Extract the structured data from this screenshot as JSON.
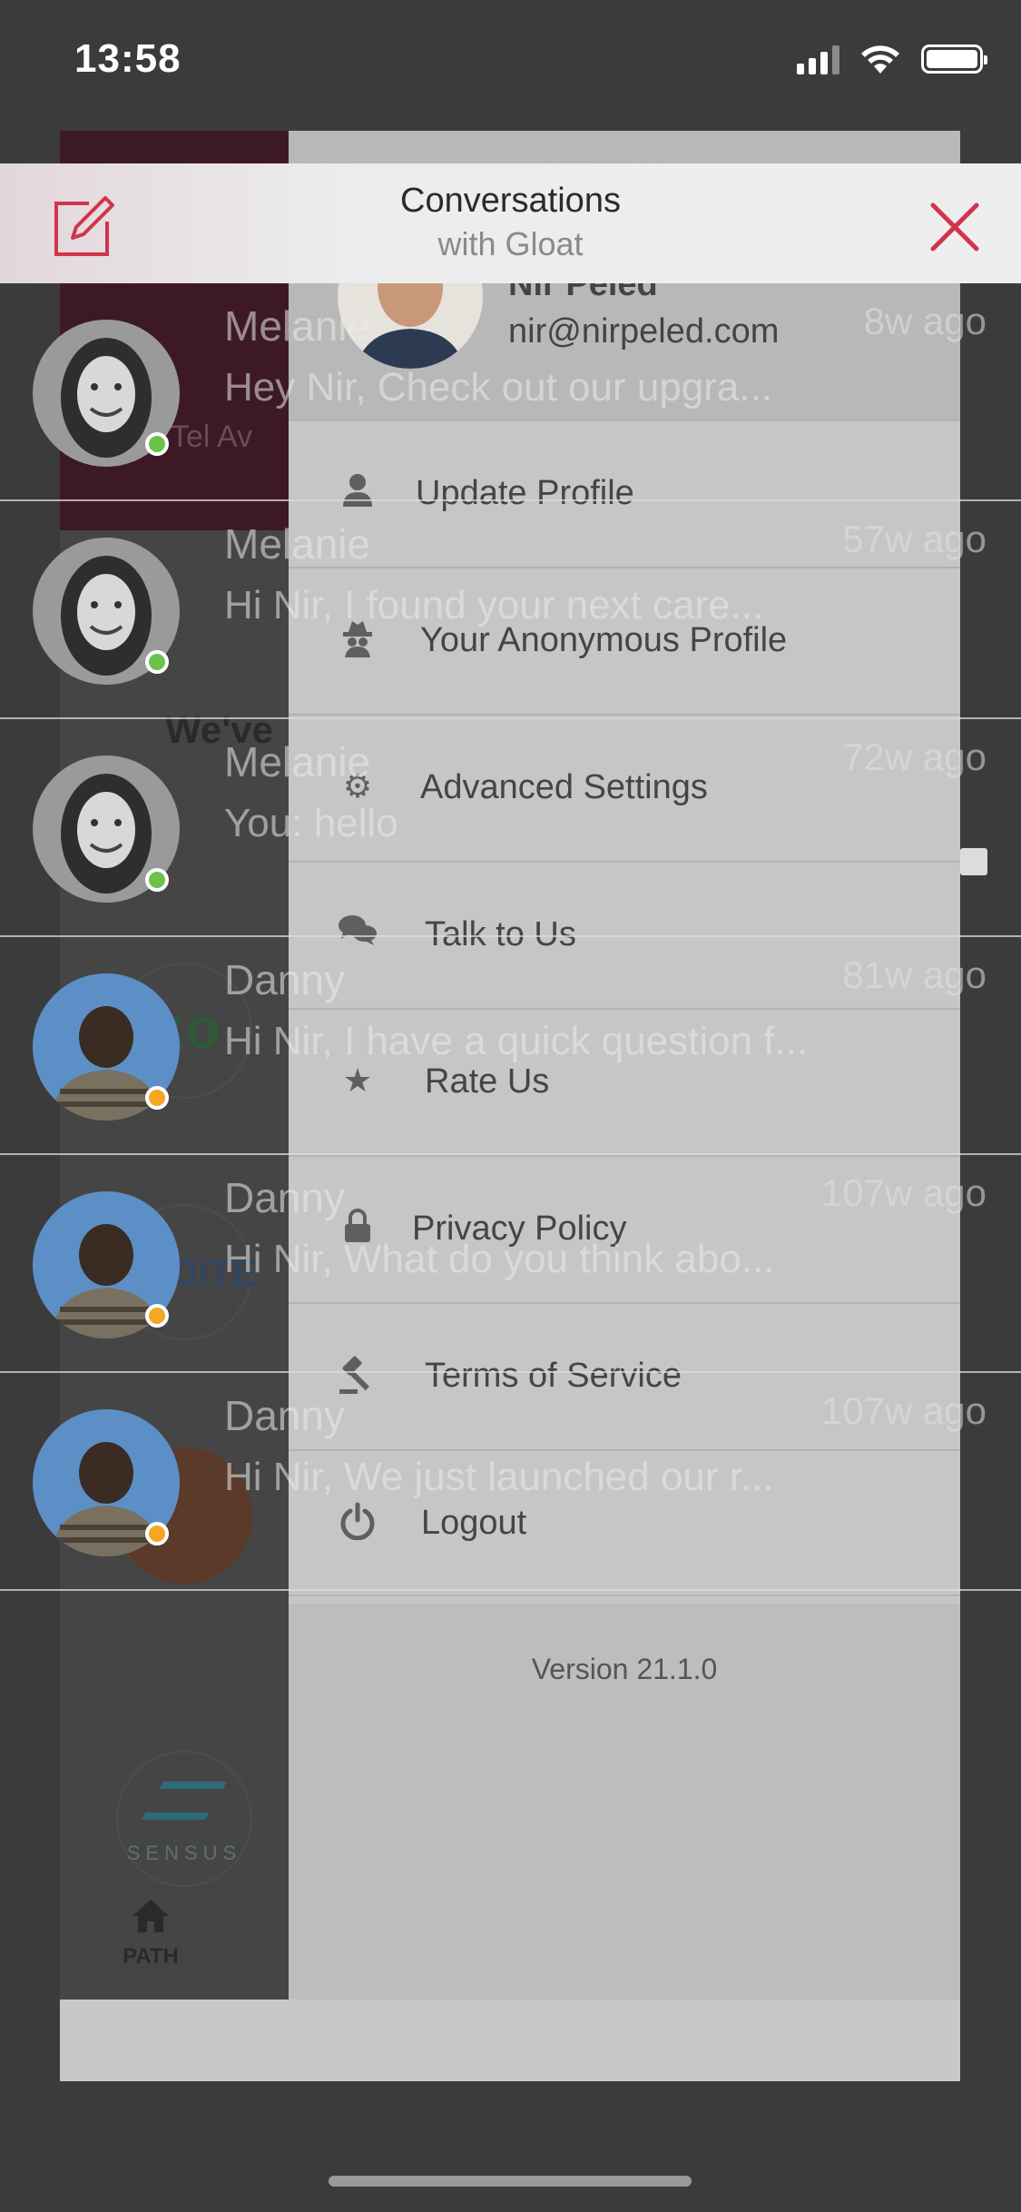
{
  "status_bar": {
    "time": "13:58"
  },
  "header": {
    "title": "Conversations",
    "subtitle": "with Gloat",
    "accent_color": "#d0354c"
  },
  "menu": {
    "user_name": "Nir Peled",
    "user_email": "nir@nirpeled.com",
    "items": [
      {
        "label": "Update Profile",
        "icon": "user-icon"
      },
      {
        "label": "Your Anonymous Profile",
        "icon": "incognito-icon"
      },
      {
        "label": "Advanced Settings",
        "icon": "gear-icon"
      },
      {
        "label": "Talk to Us",
        "icon": "chat-bubbles-icon"
      },
      {
        "label": "Rate Us",
        "icon": "star-icon"
      },
      {
        "label": "Privacy Policy",
        "icon": "lock-icon"
      },
      {
        "label": "Terms of Service",
        "icon": "gavel-icon"
      },
      {
        "label": "Logout",
        "icon": "power-icon"
      }
    ],
    "version": "Version 21.1.0"
  },
  "background": {
    "tel_text": "Tel Av",
    "we_text": "We've",
    "ko_text": "ko",
    "dite_text": "DITE",
    "sensus_text": "SENSUS",
    "path_label": "PATH"
  },
  "conversations": [
    {
      "name": "Melanie",
      "preview": "Hey Nir, Check out our upgra...",
      "time": "8w ago",
      "status_color": "#6cc24a"
    },
    {
      "name": "Melanie",
      "preview": "Hi Nir, I found your next care...",
      "time": "57w ago",
      "status_color": "#6cc24a"
    },
    {
      "name": "Melanie",
      "preview": "You: hello",
      "time": "72w ago",
      "status_color": "#6cc24a"
    },
    {
      "name": "Danny",
      "preview": "Hi Nir, I have a quick question f...",
      "time": "81w ago",
      "status_color": "#f5a623"
    },
    {
      "name": "Danny",
      "preview": "Hi Nir, What do you think abo...",
      "time": "107w ago",
      "status_color": "#f5a623"
    },
    {
      "name": "Danny",
      "preview": "Hi Nir, We just launched our r...",
      "time": "107w ago",
      "status_color": "#f5a623"
    }
  ]
}
